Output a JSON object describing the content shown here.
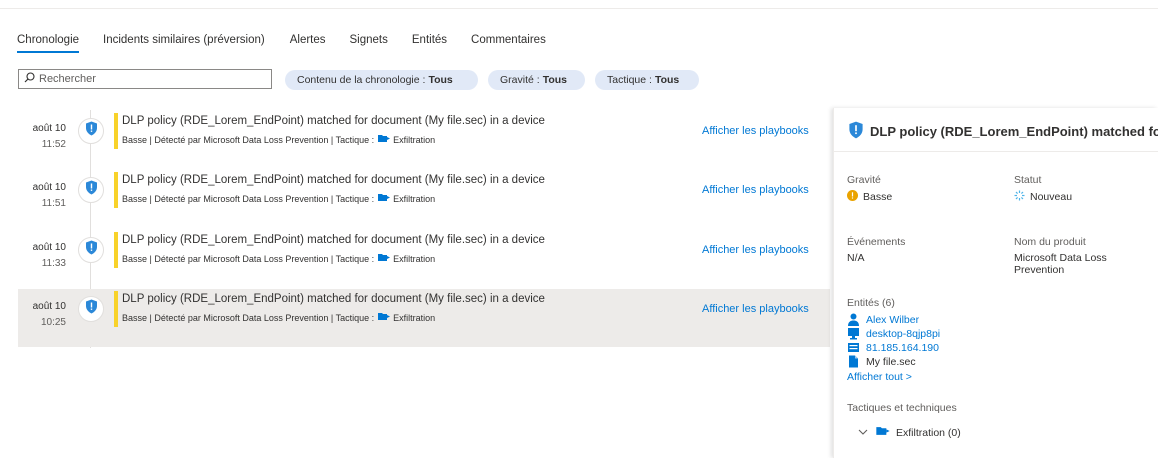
{
  "tabs": [
    {
      "label": "Chronologie"
    },
    {
      "label": "Incidents similaires (préversion)"
    },
    {
      "label": "Alertes"
    },
    {
      "label": "Signets"
    },
    {
      "label": "Entités"
    },
    {
      "label": "Commentaires"
    }
  ],
  "search": {
    "placeholder": "Rechercher"
  },
  "filters": [
    {
      "label": "Contenu de la chronologie :",
      "value": "Tous"
    },
    {
      "label": "Gravité :",
      "value": "Tous"
    },
    {
      "label": "Tactique :",
      "value": "Tous"
    }
  ],
  "timeline": [
    {
      "date": "août 10",
      "time": "11:52",
      "title": "DLP policy (RDE_Lorem_EndPoint) matched for document (My file.sec) in a device",
      "subtitle": "Basse | Détecté par Microsoft Data Loss Prevention | Tactique :",
      "tactic": "Exfiltration",
      "action": "Afficher les playbooks"
    },
    {
      "date": "août 10",
      "time": "11:51",
      "title": "DLP policy (RDE_Lorem_EndPoint) matched for document (My file.sec) in a device",
      "subtitle": "Basse | Détecté par Microsoft Data Loss Prevention | Tactique :",
      "tactic": "Exfiltration",
      "action": "Afficher les playbooks"
    },
    {
      "date": "août 10",
      "time": "11:33",
      "title": "DLP policy (RDE_Lorem_EndPoint) matched for document (My file.sec) in a device",
      "subtitle": "Basse | Détecté par Microsoft Data Loss Prevention | Tactique :",
      "tactic": "Exfiltration",
      "action": "Afficher les playbooks"
    },
    {
      "date": "août 10",
      "time": "10:25",
      "title": "DLP policy (RDE_Lorem_EndPoint) matched for document (My file.sec) in a device",
      "subtitle": "Basse | Détecté par Microsoft Data Loss Prevention | Tactique :",
      "tactic": "Exfiltration",
      "action": "Afficher les playbooks"
    }
  ],
  "panel": {
    "title": "DLP policy (RDE_Lorem_EndPoint) matched for",
    "severity_label": "Gravité",
    "severity_value": "Basse",
    "status_label": "Statut",
    "status_value": "Nouveau",
    "events_label": "Événements",
    "events_value": "N/A",
    "product_label": "Nom du produit",
    "product_value": "Microsoft Data Loss Prevention",
    "entities_label": "Entités (6)",
    "entities": [
      {
        "name": "Alex Wilber",
        "icon": "user-icon"
      },
      {
        "name": "desktop-8qjp8pi",
        "icon": "computer-icon"
      },
      {
        "name": "81.185.164.190",
        "icon": "ip-address-icon"
      },
      {
        "name": "My file.sec",
        "icon": "file-icon"
      }
    ],
    "show_all": "Afficher tout >",
    "tactics_label": "Tactiques et techniques",
    "tactic_item": "Exfiltration (0)"
  },
  "colors": {
    "accent": "#0078d4",
    "severity_low": "#f8d22a",
    "selected_row": "#edebe9",
    "pill_bg": "#e1e9f7"
  }
}
